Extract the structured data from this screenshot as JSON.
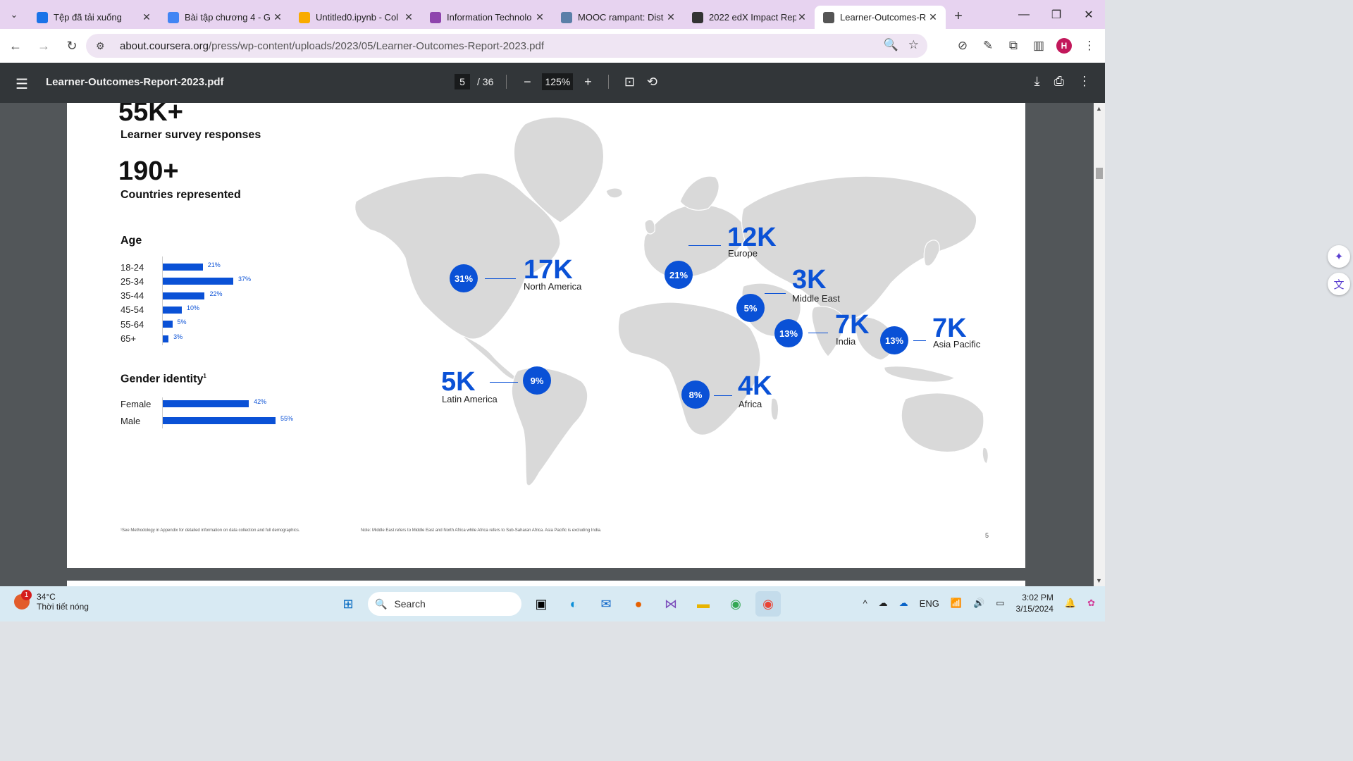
{
  "browser": {
    "tabs": [
      {
        "title": "Tệp đã tải xuống",
        "icon": "download-icon",
        "color": "#1a73e8"
      },
      {
        "title": "Bài tập chương 4 - G",
        "icon": "google-docs-icon",
        "color": "#4285f4"
      },
      {
        "title": "Untitled0.ipynb - Col",
        "icon": "colab-icon",
        "color": "#f9ab00"
      },
      {
        "title": "Information Technolo",
        "icon": "copilot-icon",
        "color": "#8e44ad"
      },
      {
        "title": "MOOC rampant: Dist",
        "icon": "site-icon",
        "color": "#5b7fa8"
      },
      {
        "title": "2022 edX Impact Rep",
        "icon": "edx-icon",
        "color": "#333333"
      },
      {
        "title": "Learner-Outcomes-R",
        "icon": "globe-icon",
        "color": "#555555"
      }
    ],
    "url_domain": "about.coursera.org",
    "url_path": "/press/wp-content/uploads/2023/05/Learner-Outcomes-Report-2023.pdf",
    "profile_initial": "H"
  },
  "pdf": {
    "filename": "Learner-Outcomes-Report-2023.pdf",
    "current_page": "5",
    "total_pages": "/ 36",
    "zoom": "125%"
  },
  "page": {
    "stats": [
      {
        "number": "55K+",
        "label": "Learner survey responses"
      },
      {
        "number": "190+",
        "label": "Countries represented"
      }
    ],
    "age_title": "Age",
    "age": [
      {
        "label": "18-24",
        "value": "21%",
        "pct": 21
      },
      {
        "label": "25-34",
        "value": "37%",
        "pct": 37
      },
      {
        "label": "35-44",
        "value": "22%",
        "pct": 22
      },
      {
        "label": "45-54",
        "value": "10%",
        "pct": 10
      },
      {
        "label": "55-64",
        "value": "5%",
        "pct": 5
      },
      {
        "label": "65+",
        "value": "3%",
        "pct": 3
      }
    ],
    "gender_title": "Gender identity",
    "gender_sup": "1",
    "gender": [
      {
        "label": "Female",
        "value": "42%",
        "pct": 42
      },
      {
        "label": "Male",
        "value": "55%",
        "pct": 55
      }
    ],
    "regions": [
      {
        "name": "North America",
        "count": "17K",
        "pct": "31%"
      },
      {
        "name": "Europe",
        "count": "12K",
        "pct": "21%"
      },
      {
        "name": "Middle East",
        "count": "3K",
        "pct": "5%"
      },
      {
        "name": "India",
        "count": "7K",
        "pct": "13%"
      },
      {
        "name": "Asia Pacific",
        "count": "7K",
        "pct": "13%"
      },
      {
        "name": "Latin America",
        "count": "5K",
        "pct": "9%"
      },
      {
        "name": "Africa",
        "count": "4K",
        "pct": "8%"
      }
    ],
    "footnote_left": "¹See Methodology in Appendix for detailed information on data collection and full demographics.",
    "footnote_right": "Note: Middle East refers to Middle East and North Africa while Africa refers to Sub-Saharan Africa. Asia Pacific is excluding India.",
    "page_number": "5"
  },
  "taskbar": {
    "weather_temp": "34°C",
    "weather_desc": "Thời tiết nóng",
    "weather_badge": "1",
    "search_label": "Search",
    "language": "ENG",
    "time": "3:02 PM",
    "date": "3/15/2024"
  },
  "colors": {
    "accent": "#0a51d6",
    "tabbar": "#e7d3f0",
    "pdf_toolbar": "#323639"
  }
}
